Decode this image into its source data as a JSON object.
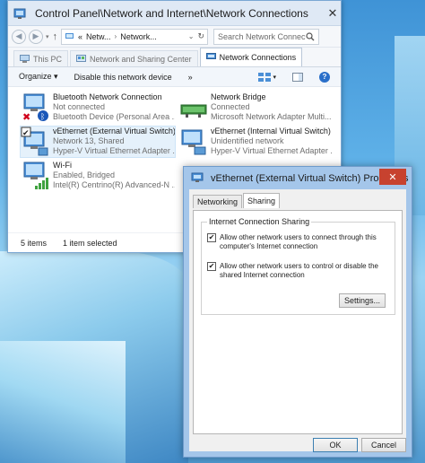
{
  "explorer": {
    "title": "Control Panel\\Network and Internet\\Network Connections",
    "address": {
      "overflow": "«",
      "segments": [
        "Netw...",
        "Network..."
      ]
    },
    "search_placeholder": "Search Network Connec...",
    "tabs": [
      {
        "label": "This PC"
      },
      {
        "label": "Network and Sharing Center"
      },
      {
        "label": "Network Connections"
      }
    ],
    "commands": {
      "organize": "Organize ▾",
      "disable": "Disable this network device",
      "more": "»",
      "help": "?"
    },
    "items": [
      {
        "name": "Bluetooth Network Connection",
        "line1": "Not connected",
        "line2": "Bluetooth Device (Personal Area ..."
      },
      {
        "name": "Network Bridge",
        "line1": "Connected",
        "line2": "Microsoft Network Adapter Multi..."
      },
      {
        "name": "vEthernet (External Virtual Switch)",
        "line1": "Network  13, Shared",
        "line2": "Hyper-V Virtual Ethernet Adapter ..."
      },
      {
        "name": "vEthernet (Internal Virtual Switch)",
        "line1": "Unidentified network",
        "line2": "Hyper-V Virtual Ethernet Adapter ..."
      },
      {
        "name": "Wi-Fi",
        "line1": "Enabled, Bridged",
        "line2": "Intel(R) Centrino(R) Advanced-N ..."
      }
    ],
    "status": {
      "count": "5 items",
      "selected": "1 item selected"
    }
  },
  "dialog": {
    "title": "vEthernet (External Virtual Switch) Properties",
    "close": "✕",
    "tabs": [
      {
        "label": "Networking"
      },
      {
        "label": "Sharing"
      }
    ],
    "group_label": "Internet Connection Sharing",
    "options": [
      {
        "label": "Allow other network users to connect through this computer's Internet connection",
        "checked": "✔"
      },
      {
        "label": "Allow other network users to control or disable the shared Internet connection",
        "checked": "✔"
      }
    ],
    "settings_label": "Settings...",
    "ok_label": "OK",
    "cancel_label": "Cancel"
  },
  "colors": {
    "accent": "#2a6fc9",
    "dialog_frame": "#a4c6ea",
    "close_red": "#c7422f",
    "selection": "#e5f1fb"
  }
}
